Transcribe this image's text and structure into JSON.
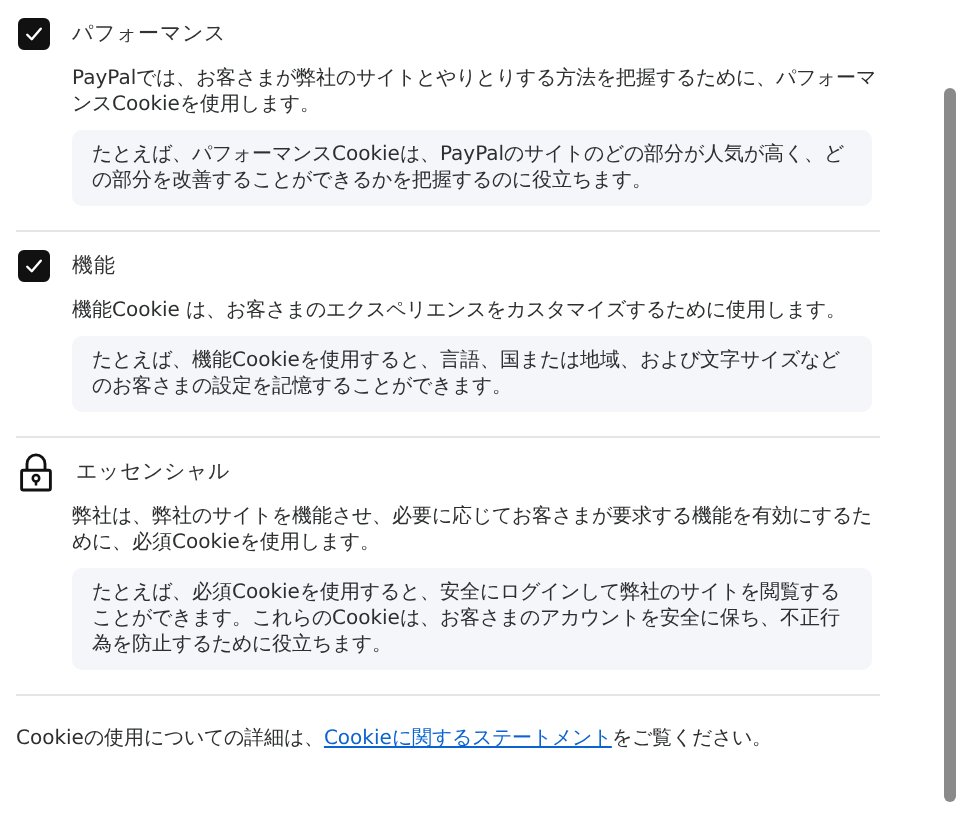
{
  "sections": [
    {
      "kind": "checkbox",
      "checked": true,
      "title": "パフォーマンス",
      "description": "PayPalでは、お客さまが弊社のサイトとやりとりする方法を把握するために、パフォーマンスCookieを使用します。",
      "example": "たとえば、パフォーマンスCookieは、PayPalのサイトのどの部分が人気が高く、どの部分を改善することができるかを把握するのに役立ちます。"
    },
    {
      "kind": "checkbox",
      "checked": true,
      "title": "機能",
      "description": "機能Cookie は、お客さまのエクスペリエンスをカスタマイズするために使用します。",
      "example": "たとえば、機能Cookieを使用すると、言語、国または地域、および文字サイズなどのお客さまの設定を記憶することができます。"
    },
    {
      "kind": "locked",
      "title": "エッセンシャル",
      "description": "弊社は、弊社のサイトを機能させ、必要に応じてお客さまが要求する機能を有効にするために、必須Cookieを使用します。",
      "example": "たとえば、必須Cookieを使用すると、安全にログインして弊社のサイトを閲覧することができます。これらのCookieは、お客さまのアカウントを安全に保ち、不正行為を防止するために役立ちます。"
    }
  ],
  "footer": {
    "before": "Cookieの使用についての詳細は、",
    "link": "Cookieに関するステートメント",
    "after": "をご覧ください。"
  }
}
